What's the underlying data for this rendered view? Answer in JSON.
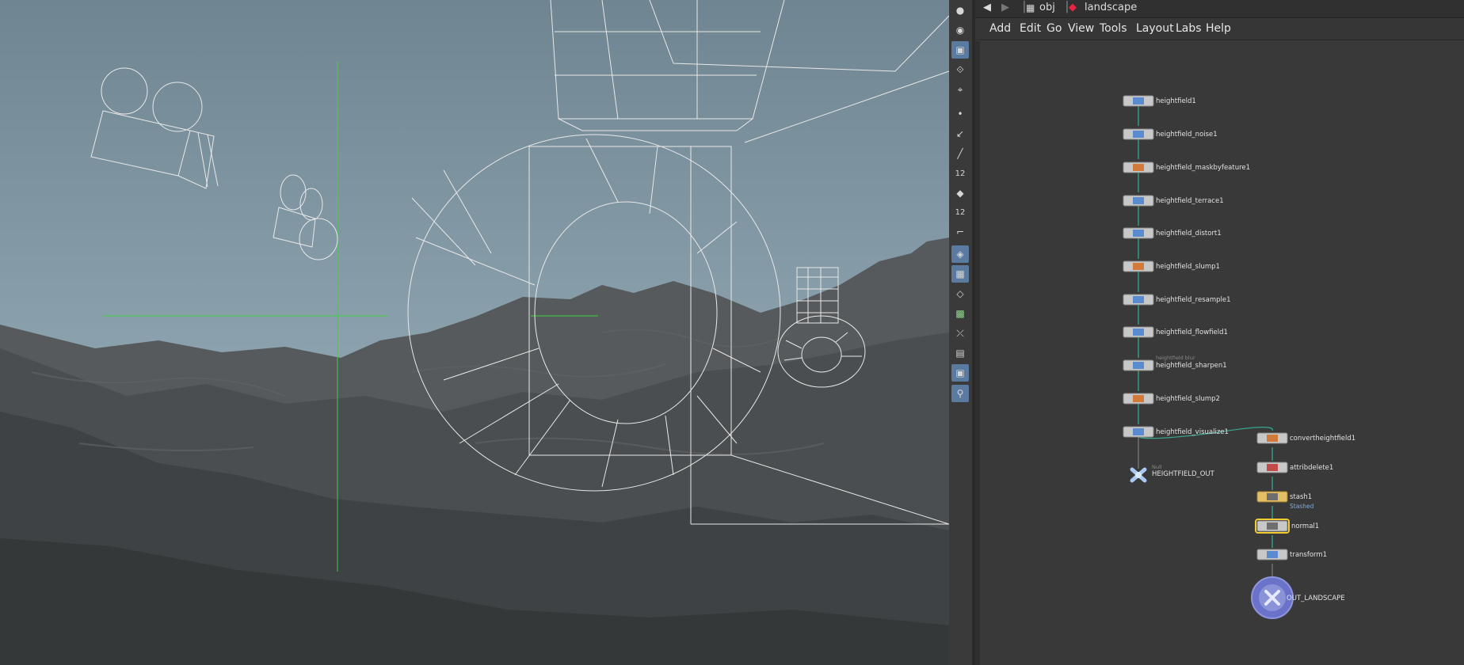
{
  "pathbar": {
    "context": "obj",
    "network": "landscape"
  },
  "menu": [
    "Add",
    "Edit",
    "Go",
    "View",
    "Tools",
    "Layout",
    "Labs",
    "Help"
  ],
  "toolbar_icons": [
    "light-icon",
    "camera-icon",
    "selection-mode-icon",
    "handle-icon",
    "geometry-icon",
    "point-icon",
    "edge-icon",
    "brush-icon",
    "number-12-icon",
    "paint-icon",
    "number-12-alt-icon",
    "corner-icon",
    "view-lock-icon",
    "display-toggle-icon",
    "layers-icon",
    "texture-icon",
    "snap-icon",
    "grid-icon",
    "camera-view-icon",
    "pin-icon"
  ],
  "toolbar_glyphs": [
    "●",
    "◉",
    "▣",
    "⟐",
    "⌖",
    "•",
    "↙",
    "╱",
    "12",
    "◆",
    "12",
    "⌐",
    "◈",
    "▦",
    "◇",
    "▩",
    "⤫",
    "▤",
    "▣",
    "⚲"
  ],
  "nodes": {
    "heightfield1": "heightfield1",
    "noise": "heightfield_noise1",
    "maskbyfeature": "heightfield_maskbyfeature1",
    "terrace": "heightfield_terrace1",
    "distort": "heightfield_distort1",
    "slump1": "heightfield_slump1",
    "resample": "heightfield_resample1",
    "flowfield": "heightfield_flowfield1",
    "sharpen": "heightfield_sharpen1",
    "sharpen_hint": "heightfield blur",
    "slump2": "heightfield_slump2",
    "visualize": "heightfield_visualize1",
    "null_type": "Null",
    "null_name": "HEIGHTFIELD_OUT",
    "convert": "convertheightfield1",
    "attribdelete": "attribdelete1",
    "stash": "stash1",
    "stash_status": "Stashed",
    "normal": "normal1",
    "transform": "transform1",
    "output": "OUT_LANDSCAPE"
  },
  "colors": {
    "sky": "#8fa6b2",
    "terrain": "#4a4d4f",
    "wire": "#e8e8e8",
    "wire_green": "#3fd23f",
    "connector": "#35a890",
    "output_node": "#6a73c9",
    "selected_outline": "#f2cc2e"
  }
}
